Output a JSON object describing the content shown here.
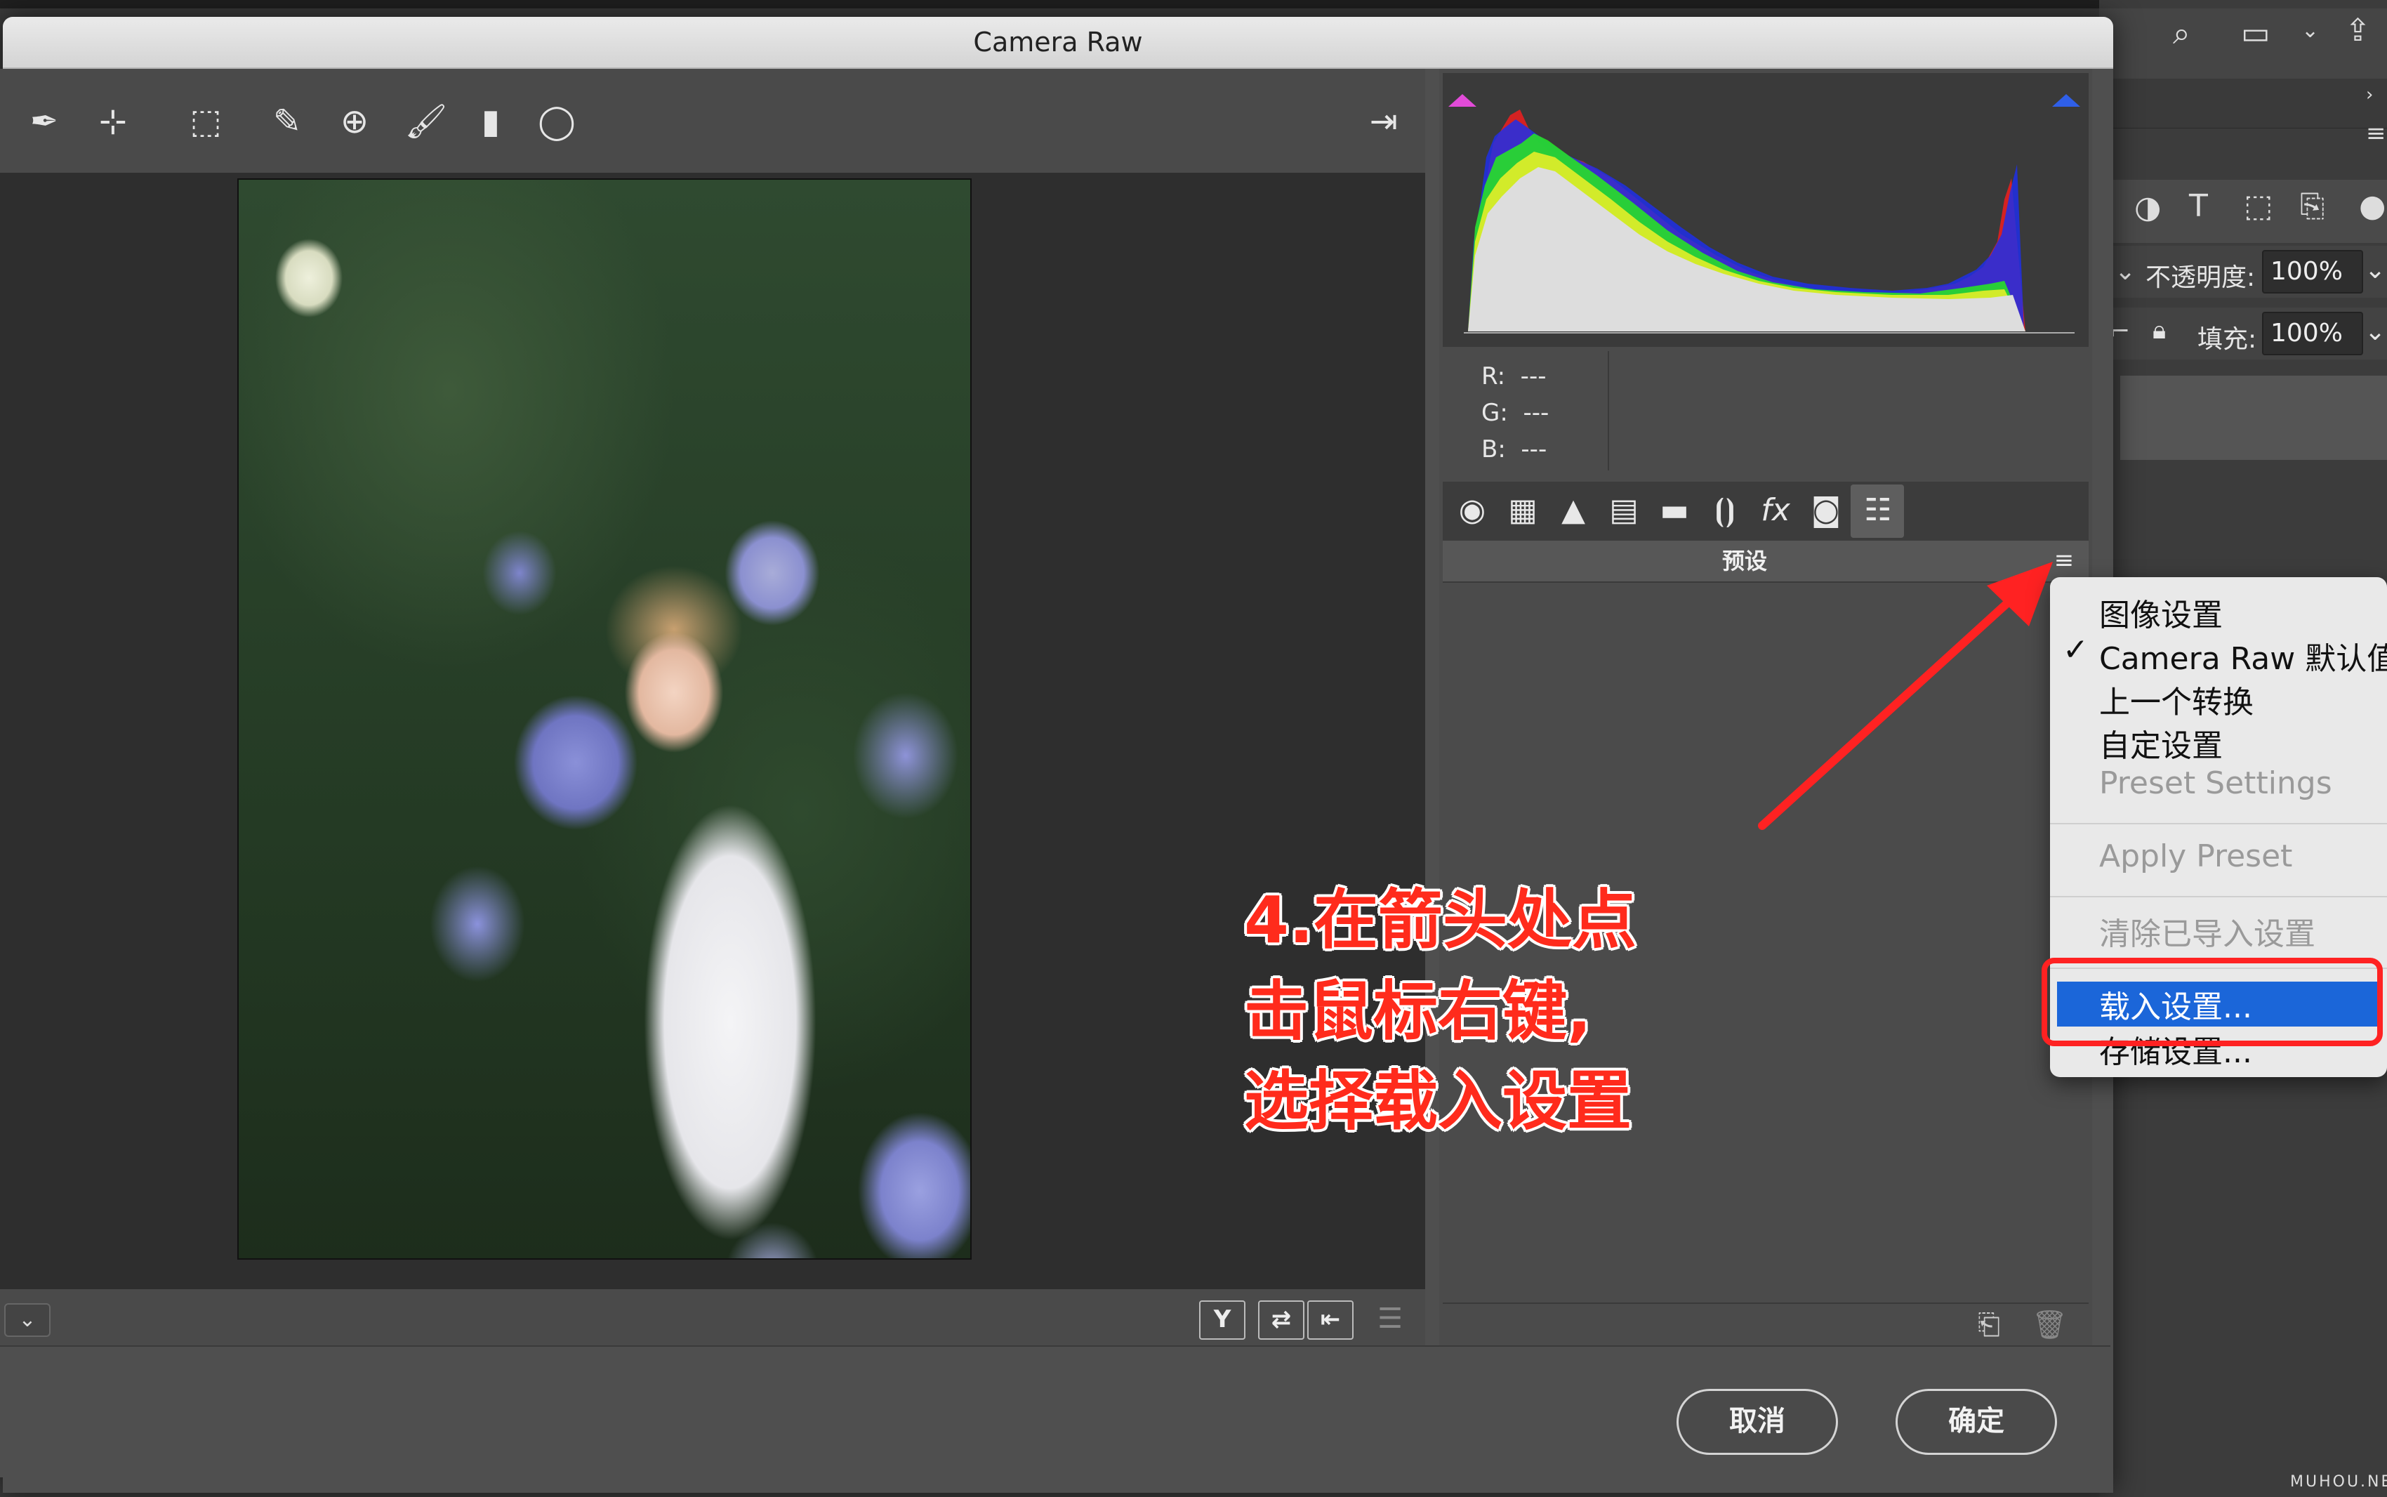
{
  "window": {
    "title": "Camera Raw"
  },
  "toolbar": {
    "tools": [
      "white-balance-icon",
      "color-sampler-icon",
      "transform-icon",
      "spot-removal-icon",
      "red-eye-icon",
      "adjustment-brush-icon",
      "graduated-filter-icon",
      "radial-filter-icon"
    ],
    "fullscreen_icon": "fullscreen-toggle-icon"
  },
  "histogram": {
    "r_label": "R:",
    "r_value": "---",
    "g_label": "G:",
    "g_value": "---",
    "b_label": "B:",
    "b_value": "---"
  },
  "panel": {
    "title": "预设",
    "tabs": [
      "basic-icon",
      "tone-curve-icon",
      "detail-icon",
      "hsl-icon",
      "split-toning-icon",
      "lens-corrections-icon",
      "effects-icon",
      "camera-calibration-icon",
      "presets-icon"
    ]
  },
  "context_menu": {
    "items": [
      {
        "label": "图像设置",
        "enabled": true,
        "checked": false
      },
      {
        "label": "Camera Raw 默认值",
        "enabled": true,
        "checked": true
      },
      {
        "label": "上一个转换",
        "enabled": true,
        "checked": false
      },
      {
        "label": "自定设置",
        "enabled": true,
        "checked": false
      },
      {
        "label": "Preset Settings",
        "enabled": false,
        "checked": false
      },
      {
        "label": "Apply Preset",
        "enabled": false,
        "checked": false
      },
      {
        "label": "清除已导入设置",
        "enabled": false,
        "checked": false
      },
      {
        "label": "载入设置...",
        "enabled": true,
        "checked": false,
        "highlighted": true
      },
      {
        "label": "存储设置...",
        "enabled": true,
        "checked": false
      }
    ],
    "check_mark": "✓"
  },
  "annotation": {
    "line1": "4.在箭头处点",
    "line2": "击鼠标右键,",
    "line3": "选择载入设置"
  },
  "buttons": {
    "cancel": "取消",
    "ok": "确定"
  },
  "photoshop": {
    "opacity_label": "不透明度:",
    "opacity_value": "100%",
    "fill_label": "填充:",
    "fill_value": "100%"
  },
  "watermark": "MUHOU.NET",
  "colors": {
    "highlight": "#1b66d9",
    "annotation_red": "#ff2b1c"
  }
}
